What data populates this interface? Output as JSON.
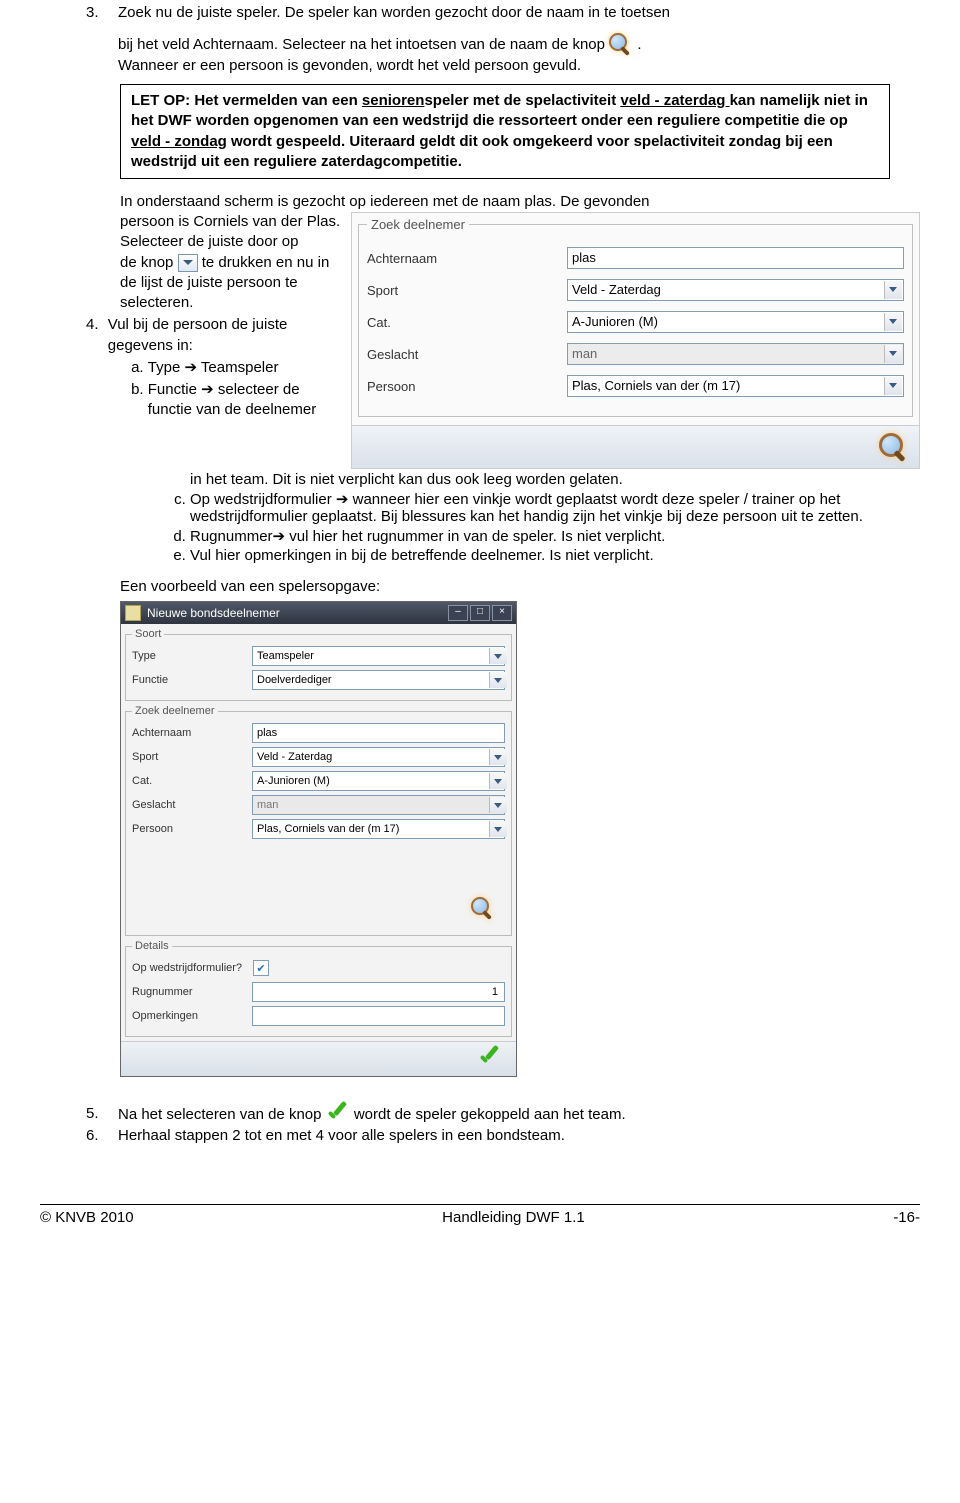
{
  "step3": {
    "num": "3.",
    "line1a": "Zoek nu de juiste speler. De speler kan worden gezocht door de naam in te toetsen",
    "line2a": "bij het veld Achternaam. Selecteer na het intoetsen van de naam de knop ",
    "line2b": ".",
    "line3": "Wanneer er een persoon is gevonden, wordt het veld persoon gevuld."
  },
  "warn": {
    "t1a": "LET OP: Het vermelden van een ",
    "t1b": "senioren",
    "t1c": "speler met de spelactiviteit",
    "t2a": "veld - zaterdag ",
    "t2b": "kan namelijk niet in het DWF worden opgenomen van een wedstrijd die ressorteert onder een reguliere competitie die op ",
    "t2c": "veld - zondag",
    "t2d": " wordt gespeeld. Uiteraard geldt dit ook omgekeerd voor spelactiviteit zondag bij een wedstrijd uit een reguliere zaterdagcompetitie."
  },
  "intro2": "In onderstaand scherm is gezocht op iedereen met de naam plas. De gevonden",
  "leftcol": {
    "a": "persoon is Corniels van der Plas.",
    "b": "Selecteer de juiste door op",
    "c1": "de knop ",
    "c2": " te drukken en nu in de lijst de juiste persoon te selecteren."
  },
  "step4": {
    "num": "4.",
    "lead": "Vul bij de persoon de juiste gegevens in:",
    "a1": "Type ",
    "a2": " Teamspeler",
    "b1": "Functie ",
    "b2": " selecteer de functie van de deelnemer",
    "b_cont": "in het team. Dit is niet verplicht kan dus ook leeg worden gelaten.",
    "c1": "Op wedstrijdformulier ",
    "c2": " wanneer hier een vinkje wordt geplaatst wordt deze speler / trainer op het wedstrijdformulier geplaatst. Bij blessures kan het handig zijn het vinkje bij deze persoon uit te zetten.",
    "d1": "Rugnummer",
    "d2": " vul hier het rugnummer in van de speler. Is niet verplicht.",
    "e": "Vul hier opmerkingen in bij de betreffende deelnemer. Is niet verplicht."
  },
  "example_label": "Een voorbeeld van een spelersopgave:",
  "panel1": {
    "legend": "Zoek deelnemer",
    "achternaam_lab": "Achternaam",
    "achternaam_val": "plas",
    "sport_lab": "Sport",
    "sport_val": "Veld - Zaterdag",
    "cat_lab": "Cat.",
    "cat_val": "A-Junioren (M)",
    "geslacht_lab": "Geslacht",
    "geslacht_val": "man",
    "persoon_lab": "Persoon",
    "persoon_val": "Plas, Corniels van der (m 17)"
  },
  "win": {
    "title": "Nieuwe bondsdeelnemer",
    "soort_legend": "Soort",
    "type_lab": "Type",
    "type_val": "Teamspeler",
    "functie_lab": "Functie",
    "functie_val": "Doelverdediger",
    "zoek_legend": "Zoek deelnemer",
    "achternaam_lab": "Achternaam",
    "achternaam_val": "plas",
    "sport_lab": "Sport",
    "sport_val": "Veld - Zaterdag",
    "cat_lab": "Cat.",
    "cat_val": "A-Junioren (M)",
    "geslacht_lab": "Geslacht",
    "geslacht_val": "man",
    "persoon_lab": "Persoon",
    "persoon_val": "Plas, Corniels van der (m 17)",
    "details_legend": "Details",
    "opwed_lab": "Op wedstrijdformulier?",
    "rug_lab": "Rugnummer",
    "rug_val": "1",
    "opm_lab": "Opmerkingen"
  },
  "step5": {
    "num": "5.",
    "a": "Na het selecteren van de knop ",
    "b": " wordt de speler gekoppeld aan het team."
  },
  "step6": {
    "num": "6.",
    "text": "Herhaal stappen 2 tot en met 4 voor alle spelers in een bondsteam."
  },
  "footer": {
    "left": "© KNVB 2010",
    "mid": "Handleiding DWF 1.1",
    "right": "-16-"
  },
  "arrow": "➔"
}
